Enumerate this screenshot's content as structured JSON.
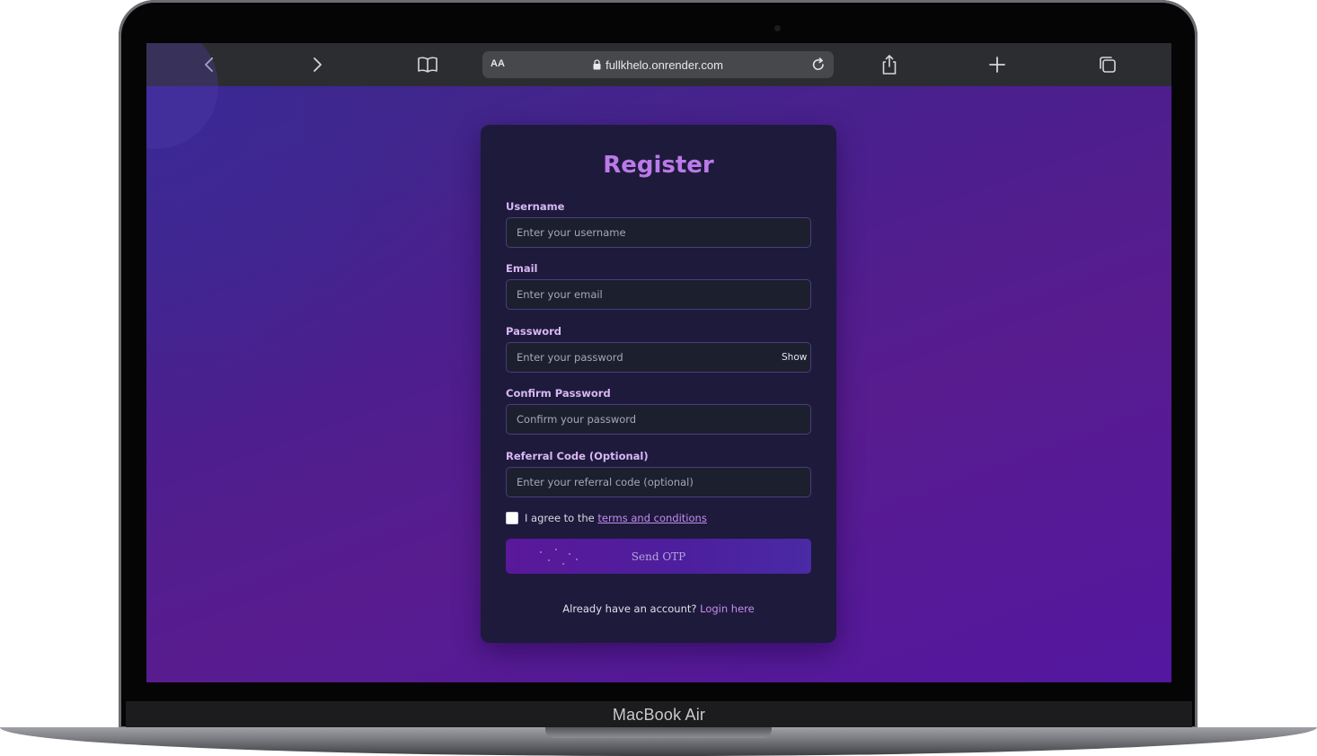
{
  "device": {
    "model_label": "MacBook Air"
  },
  "browser": {
    "text_size_label": "AA",
    "url": "fullkhelo.onrender.com"
  },
  "form": {
    "title": "Register",
    "fields": [
      {
        "label": "Username",
        "placeholder": "Enter your username"
      },
      {
        "label": "Email",
        "placeholder": "Enter your email"
      },
      {
        "label": "Password",
        "placeholder": "Enter your password"
      },
      {
        "label": "Confirm Password",
        "placeholder": "Confirm your password"
      },
      {
        "label": "Referral Code (Optional)",
        "placeholder": "Enter your referral code (optional)"
      }
    ],
    "show_password_label": "Show",
    "terms_prefix": "I agree to the",
    "terms_link": "terms and conditions",
    "submit_label": "Send OTP",
    "login_prompt": "Already have an account?",
    "login_link": "Login here"
  },
  "colors": {
    "page_gradient_start": "#3b2a8a",
    "page_gradient_end": "#5417a0",
    "card_background": "#1e1a3b",
    "title_color": "#bb7ae9",
    "link_color": "#c48df0",
    "button_color": "#5a189a"
  },
  "icons": [
    "back-icon",
    "forward-icon",
    "bookmarks-icon",
    "lock-icon",
    "reload-icon",
    "share-icon",
    "new-tab-icon",
    "tabs-icon"
  ]
}
